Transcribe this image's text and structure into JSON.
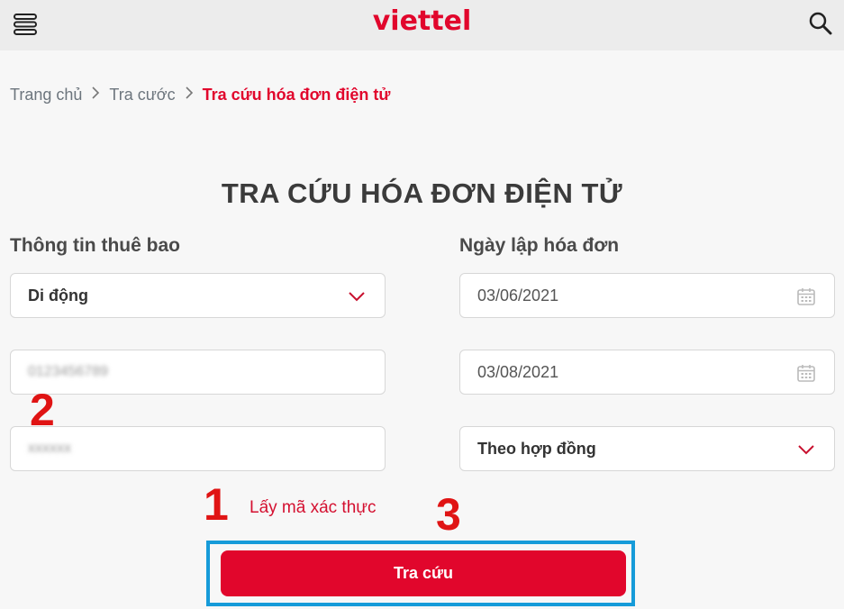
{
  "header": {
    "logo_text": "viettel",
    "menu_icon": "hamburger-menu-icon",
    "search_icon": "search-icon",
    "brand_color": "#e1062c"
  },
  "breadcrumb": {
    "items": [
      "Trang chủ",
      "Tra cước",
      "Tra cứu hóa đơn điện tử"
    ],
    "separator_icon": "chevron-right-icon"
  },
  "page_title": "TRA CỨU HÓA ĐƠN ĐIỆN TỬ",
  "form": {
    "subscriber_label": "Thông tin thuê bao",
    "subscriber_type": "Di động",
    "phone_number": "0123456789",
    "otp_code": "xxxxxx",
    "invoice_date_label": "Ngày lập hóa đơn",
    "date_from": "03/06/2021",
    "date_to": "03/08/2021",
    "lookup_type": "Theo hợp đồng",
    "get_otp_link": "Lấy mã xác thực",
    "submit_label": "Tra cứu"
  },
  "annotations": {
    "marker_1": "1",
    "marker_2": "2",
    "marker_3": "3",
    "marker_color": "#e01414",
    "highlight_color": "#169bd9"
  }
}
